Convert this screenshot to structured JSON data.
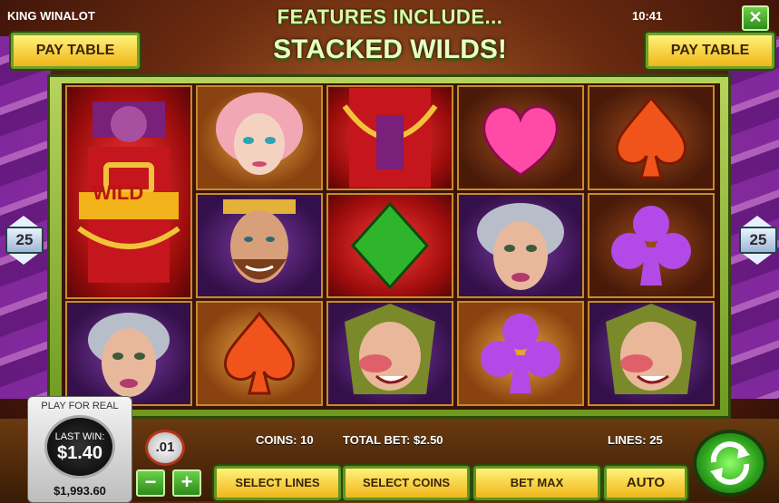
{
  "header": {
    "game_title": "KING WINALOT",
    "clock": "10:41",
    "close_label": "✕",
    "headline_line1": "FEATURES INCLUDE...",
    "headline_line2": "STACKED WILDS!"
  },
  "buttons": {
    "pay_table_left": "PAY TABLE",
    "pay_table_right": "PAY TABLE",
    "select_lines": "SELECT LINES",
    "select_coins": "SELECT COINS",
    "bet_max": "BET MAX",
    "auto": "AUTO",
    "minus": "−",
    "plus": "+",
    "coin_chip": ".01"
  },
  "lines_indicator": {
    "left": "25",
    "right": "25"
  },
  "reels": [
    [
      "wild-king",
      "wild-king",
      "old-lady"
    ],
    [
      "princess",
      "king",
      "spade-orange"
    ],
    [
      "wild-king",
      "diamond-green",
      "jester"
    ],
    [
      "heart-pink",
      "old-lady",
      "club-purple"
    ],
    [
      "spade-orange",
      "club-purple",
      "jester"
    ]
  ],
  "wild_label": "WILD",
  "info_bar": {
    "coins": "COINS: 10",
    "total_bet": "TOTAL BET: $2.50",
    "lines": "LINES: 25"
  },
  "wallet": {
    "mode": "PLAY FOR REAL",
    "last_win_label": "LAST WIN:",
    "last_win_value": "$1.40",
    "balance": "$1,993.60"
  },
  "colors": {
    "accent_green": "#6fd04a",
    "button_gold": "#f0b619",
    "frame_green": "#8fb83a"
  }
}
